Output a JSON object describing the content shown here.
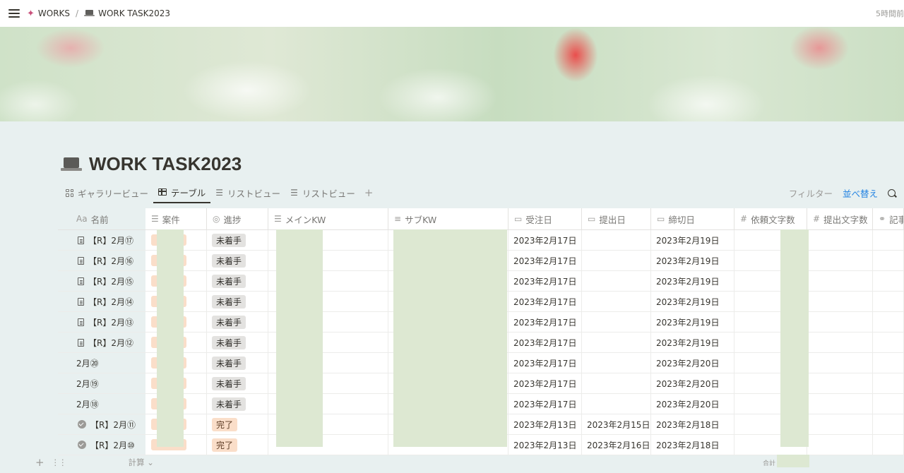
{
  "topbar": {
    "workspace": "WORKS",
    "separator": "/",
    "page": "WORK TASK2023",
    "edited": "5時間前"
  },
  "page": {
    "title": "WORK TASK2023"
  },
  "views": [
    {
      "label": "ギャラリービュー",
      "icon": "gallery-icon",
      "active": false
    },
    {
      "label": "テーブル",
      "icon": "table-icon",
      "active": true
    },
    {
      "label": "リストビュー",
      "icon": "list-icon",
      "active": false
    },
    {
      "label": "リストビュー",
      "icon": "list-icon",
      "active": false
    }
  ],
  "view_actions": {
    "add": "+",
    "filter": "フィルター",
    "sort": "並べ替え"
  },
  "columns": [
    {
      "label": "名前",
      "icon": "Aa"
    },
    {
      "label": "案件",
      "icon": "☰"
    },
    {
      "label": "進捗",
      "icon": "◎"
    },
    {
      "label": "メインKW",
      "icon": "☰"
    },
    {
      "label": "サブKW",
      "icon": "≡"
    },
    {
      "label": "受注日",
      "icon": "▭"
    },
    {
      "label": "提出日",
      "icon": "▭"
    },
    {
      "label": "締切日",
      "icon": "▭"
    },
    {
      "label": "依頼文字数",
      "icon": "#"
    },
    {
      "label": "提出文字数",
      "icon": "#"
    },
    {
      "label": "記事",
      "icon": "⚭"
    }
  ],
  "rows": [
    {
      "name": "【R】2月⑰",
      "icon": "doc",
      "status": "未着手",
      "status_type": "todo",
      "ordered": "2023年2月17日",
      "submitted": "",
      "due": "2023年2月19日"
    },
    {
      "name": "【R】2月⑯",
      "icon": "doc",
      "status": "未着手",
      "status_type": "todo",
      "ordered": "2023年2月17日",
      "submitted": "",
      "due": "2023年2月19日"
    },
    {
      "name": "【R】2月⑮",
      "icon": "doc",
      "status": "未着手",
      "status_type": "todo",
      "ordered": "2023年2月17日",
      "submitted": "",
      "due": "2023年2月19日"
    },
    {
      "name": "【R】2月⑭",
      "icon": "doc",
      "status": "未着手",
      "status_type": "todo",
      "ordered": "2023年2月17日",
      "submitted": "",
      "due": "2023年2月19日"
    },
    {
      "name": "【R】2月⑬",
      "icon": "doc",
      "status": "未着手",
      "status_type": "todo",
      "ordered": "2023年2月17日",
      "submitted": "",
      "due": "2023年2月19日"
    },
    {
      "name": "【R】2月⑫",
      "icon": "doc",
      "status": "未着手",
      "status_type": "todo",
      "ordered": "2023年2月17日",
      "submitted": "",
      "due": "2023年2月19日"
    },
    {
      "name": "2月⑳",
      "icon": "none",
      "status": "未着手",
      "status_type": "todo",
      "ordered": "2023年2月17日",
      "submitted": "",
      "due": "2023年2月20日"
    },
    {
      "name": "2月⑲",
      "icon": "none",
      "status": "未着手",
      "status_type": "todo",
      "ordered": "2023年2月17日",
      "submitted": "",
      "due": "2023年2月20日"
    },
    {
      "name": "2月⑱",
      "icon": "none",
      "status": "未着手",
      "status_type": "todo",
      "ordered": "2023年2月17日",
      "submitted": "",
      "due": "2023年2月20日"
    },
    {
      "name": "【R】2月⑪",
      "icon": "check",
      "status": "完了",
      "status_type": "done",
      "ordered": "2023年2月13日",
      "submitted": "2023年2月15日",
      "due": "2023年2月18日"
    },
    {
      "name": "【R】2月⑩",
      "icon": "check",
      "status": "完了",
      "status_type": "done",
      "ordered": "2023年2月13日",
      "submitted": "2023年2月16日",
      "due": "2023年2月18日"
    }
  ],
  "footer": {
    "add": "+",
    "calculate": "計算 ⌄",
    "total": "合計"
  },
  "colors": {
    "accent": "#2383e2",
    "todo_tag": "#e3e2e0",
    "done_tag": "#fadec9",
    "mask": "#dde8d2"
  }
}
